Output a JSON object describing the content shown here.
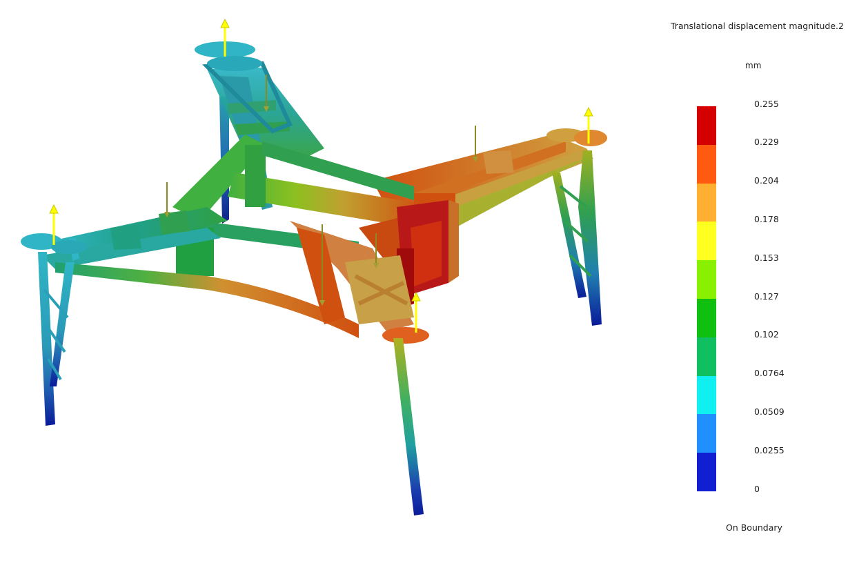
{
  "legend": {
    "title": "Translational displacement magnitude.2",
    "unit": "mm",
    "footer": "On Boundary",
    "ticks": [
      "0.255",
      "0.229",
      "0.204",
      "0.178",
      "0.153",
      "0.127",
      "0.102",
      "0.0764",
      "0.0509",
      "0.0255",
      "0"
    ],
    "colors": [
      "#d40000",
      "#ff5a10",
      "#ffb030",
      "#ffff20",
      "#88f000",
      "#10c010",
      "#10c060",
      "#10f0f0",
      "#2090ff",
      "#1020d0"
    ]
  },
  "palette": {
    "leg_bottom": "#0a1a9a",
    "leg_mid": "#3aa0c0",
    "cyan_arm": "#2fb5c5",
    "teal_arm": "#20a090",
    "green_frame": "#30a040",
    "lime": "#8cc020",
    "olive": "#b0a030",
    "tan": "#d09040",
    "orange_red": "#d05010",
    "red": "#c01010",
    "arrow_yellow": "#ffff00",
    "arrow_olive": "#8a8a20"
  }
}
